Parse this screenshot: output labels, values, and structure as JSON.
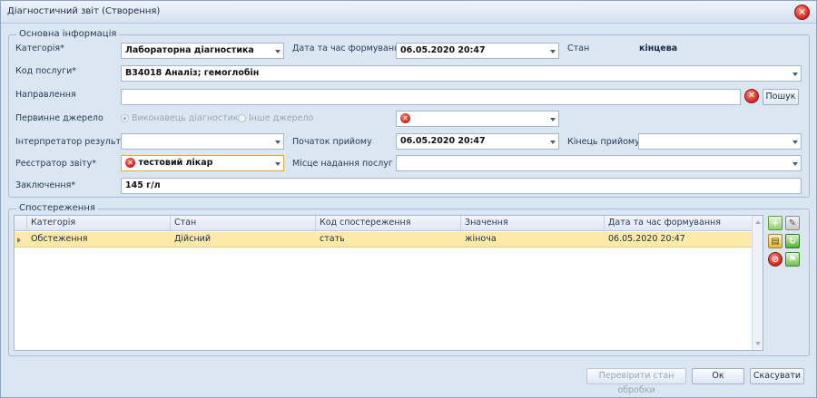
{
  "window": {
    "title": "Діагностичний звіт (Створення)",
    "close_glyph": "✕"
  },
  "basic": {
    "group_title": "Основна інформація",
    "category_label": "Категорія*",
    "category_value": "Лабораторна діагностика",
    "datetime_label": "Дата та час формування*",
    "datetime_value": "06.05.2020 20:47",
    "state_label": "Стан",
    "state_value": "кінцева",
    "service_code_label": "Код послуги*",
    "service_code_value": "B34018 Аналіз; гемоглобін",
    "referral_label": "Направлення",
    "referral_value": "",
    "search_label": "Пошук",
    "primary_source_label": "Первинне джерело",
    "radio_performer": "Виконавець діагностики",
    "radio_other": "Інше джерело",
    "interpreter_label": "Інтерпретатор результату",
    "interpreter_value": "",
    "start_label": "Початок прийому",
    "start_value": "06.05.2020 20:47",
    "end_label": "Кінець прийому",
    "end_value": "",
    "registrar_label": "Реєстратор звіту*",
    "registrar_value": "тестовий лікар",
    "place_label": "Місце надання послуг",
    "place_value": "",
    "conclusion_label": "Заключення*",
    "conclusion_value": "145 г/л"
  },
  "observations": {
    "group_title": "Спостереження",
    "columns": [
      "Категорія",
      "Стан",
      "Код спостереження",
      "Значення",
      "Дата та час формування"
    ],
    "rows": [
      [
        "Обстеження",
        "Дійсний",
        "стать",
        "жіноча",
        "06.05.2020 20:47"
      ]
    ]
  },
  "toolbar_icons": [
    "add-icon",
    "edit-icon",
    "copy-icon",
    "refresh-icon",
    "delete-icon",
    "flag-icon"
  ],
  "footer": {
    "check_label": "Перевірити стан обробки",
    "ok_label": "Ок",
    "cancel_label": "Скасувати"
  }
}
